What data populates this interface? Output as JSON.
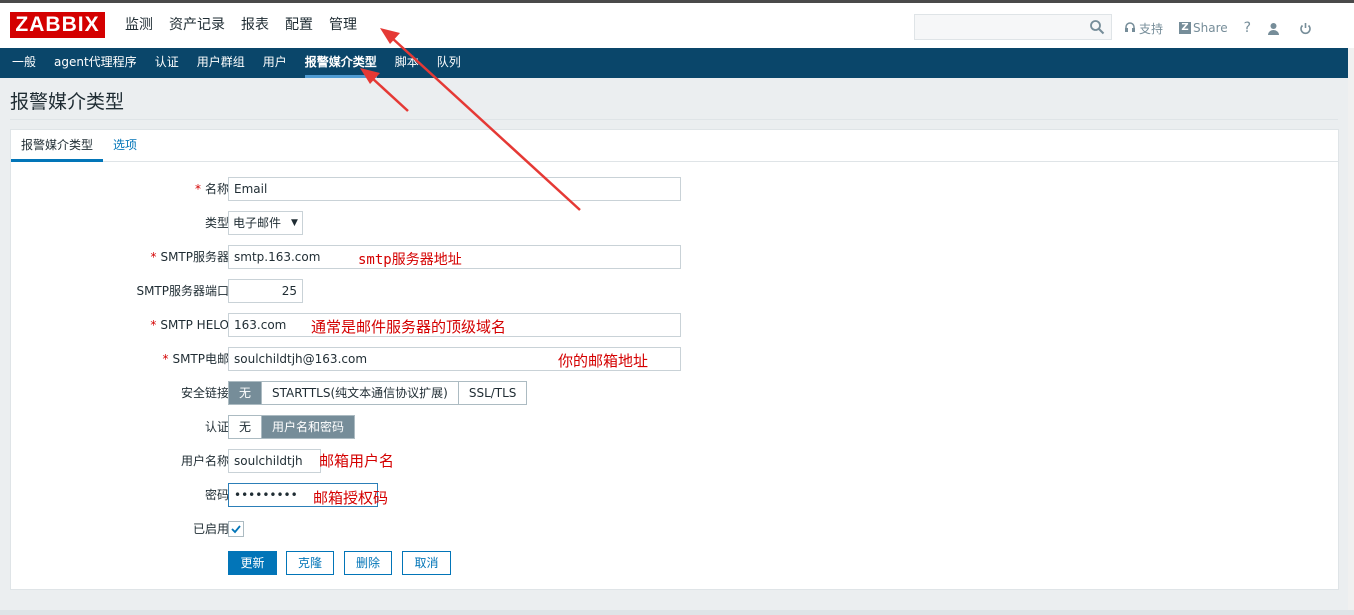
{
  "logo": "ZABBIX",
  "top_menu": [
    "监测",
    "资产记录",
    "报表",
    "配置",
    "管理"
  ],
  "top_links": {
    "support": "支持",
    "share": "Share",
    "help": "?"
  },
  "sub_menu": [
    "一般",
    "agent代理程序",
    "认证",
    "用户群组",
    "用户",
    "报警媒介类型",
    "脚本",
    "队列"
  ],
  "page_title": "报警媒介类型",
  "tabs": [
    "报警媒介类型",
    "选项"
  ],
  "form": {
    "name": {
      "label": "名称",
      "value": "Email"
    },
    "type": {
      "label": "类型",
      "value": "电子邮件"
    },
    "smtp_server": {
      "label": "SMTP服务器",
      "value": "smtp.163.com"
    },
    "smtp_port": {
      "label": "SMTP服务器端口",
      "value": "25"
    },
    "smtp_helo": {
      "label": "SMTP HELO",
      "value": "163.com"
    },
    "smtp_email": {
      "label": "SMTP电邮",
      "value": "soulchildtjh@163.com"
    },
    "security": {
      "label": "安全链接",
      "options": [
        "无",
        "STARTTLS(纯文本通信协议扩展)",
        "SSL/TLS"
      ],
      "selected": "无"
    },
    "auth": {
      "label": "认证",
      "options": [
        "无",
        "用户名和密码"
      ],
      "selected": "用户名和密码"
    },
    "username": {
      "label": "用户名称",
      "value": "soulchildtjh"
    },
    "password": {
      "label": "密码",
      "value": "•••••••••"
    },
    "enabled": {
      "label": "已启用",
      "checked": true
    }
  },
  "buttons": {
    "update": "更新",
    "clone": "克隆",
    "delete": "删除",
    "cancel": "取消"
  },
  "annotations": {
    "smtp_server": "smtp服务器地址",
    "helo": "通常是邮件服务器的顶级域名",
    "email": "你的邮箱地址",
    "username": "邮箱用户名",
    "password": "邮箱授权码"
  },
  "colors": {
    "accent": "#0275b8",
    "nav": "#0a466a",
    "logo": "#d40000",
    "annotation": "#d40000"
  }
}
